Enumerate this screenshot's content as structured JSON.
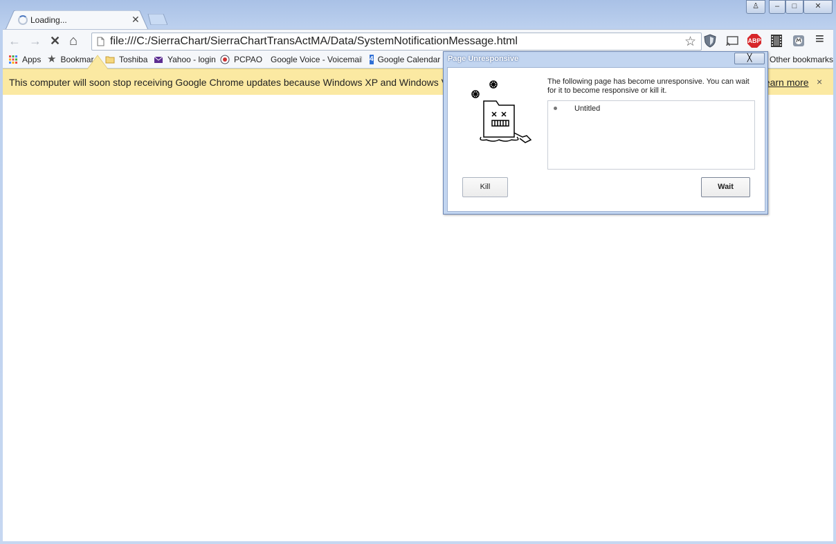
{
  "tab": {
    "title": "Loading..."
  },
  "caption": {
    "user": "♙",
    "minimize": "–",
    "restore": "□",
    "close": "✕"
  },
  "toolbar": {
    "url": "file:///C:/SierraChart/SierraChartTransActMA/Data/SystemNotificationMessage.html",
    "back_icon": "←",
    "forward_icon": "→",
    "stop_icon": "✕",
    "home_icon": "⌂",
    "star_icon": "☆",
    "abp_label": "ABP",
    "menu_icon": "≡"
  },
  "bookmarks": {
    "items": [
      {
        "label": "Apps"
      },
      {
        "label": "Bookmarks"
      },
      {
        "label": "Toshiba"
      },
      {
        "label": "Yahoo - login"
      },
      {
        "label": "PCPAO"
      },
      {
        "label": "Google Voice - Voicemails"
      },
      {
        "label": "Google Calendar -"
      }
    ],
    "other": "Other bookmarks",
    "calendar_day": "4"
  },
  "infobar": {
    "message": "This computer will soon stop receiving Google Chrome updates because Windows XP and Windows Vista",
    "link": "Learn more",
    "close": "×"
  },
  "dialog": {
    "title": "Page Unresponsive",
    "close": "╳",
    "message": "The following page has become unresponsive. You can wait for it to become responsive or kill it.",
    "list": [
      "Untitled"
    ],
    "kill_label": "Kill",
    "wait_label": "Wait"
  },
  "colors": {
    "infobar_bg": "#fbe9a2",
    "frame": "#a9c1e6",
    "abp_red": "#d7262a"
  }
}
